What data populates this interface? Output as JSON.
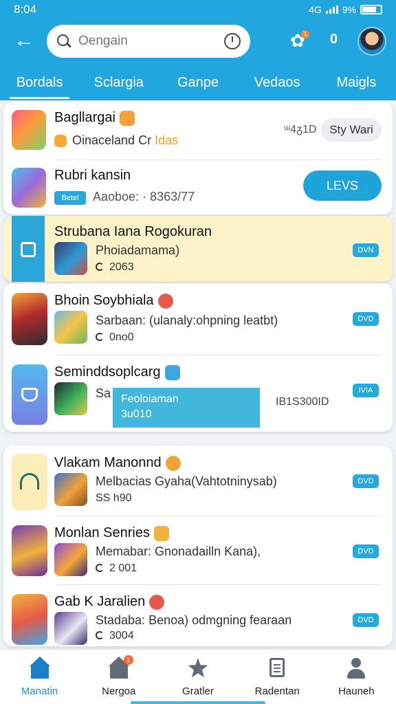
{
  "status": {
    "time": "8:04",
    "network": "4G",
    "battery_label": "9%"
  },
  "header": {
    "search_placeholder": "Oengain",
    "coin_count": "0",
    "notification_count": "1"
  },
  "tabs": [
    "Bordals",
    "Sclargia",
    "Ganpe",
    "Vedaos",
    "Maigls"
  ],
  "top_card": {
    "items": [
      {
        "title": "Bagllargai",
        "sub": "Oinaceland Cr",
        "sub_highlight": "Idas",
        "meta": "ᵚ4ᵹ1D",
        "button": "Sty Wari"
      },
      {
        "title": "Rubri kansin",
        "tag": "Betel",
        "sub": "Aaoboe: ·  8363/77",
        "button": "LEVS"
      }
    ]
  },
  "featured": {
    "title": "Strubana Iana Rogokuran",
    "sub": "Phoiadamama)",
    "meta": "2063",
    "badge": "DVN"
  },
  "card_two": [
    {
      "title": "Bhoin Soybhiala",
      "sub": "Sarbaan: (ulanaly:ohpning leatbt)",
      "meta": "0no0",
      "badge": "DVD"
    },
    {
      "title": "Seminddsoplcarg",
      "sub": "Sa",
      "meta": "",
      "badge": "IVIA",
      "side_meta": "IB1S300ID"
    }
  ],
  "tooltip": {
    "line1": "Feoloiaman",
    "line2": "3u010"
  },
  "card_three": [
    {
      "title": "Vlakam Manonnd",
      "sub": "Melbacias Gyaha(Vahtotninysab)",
      "meta": "SS  h90",
      "badge": "DVD"
    },
    {
      "title": "Monlan Senries",
      "sub": "Memabar: Gnonadailln Kana),",
      "meta": "2 001",
      "badge": "DVD"
    },
    {
      "title": "Gab K Jaralien",
      "sub": "Stadaba: Benoa) odmgning fearaan",
      "meta": "3004",
      "badge": "DVD"
    }
  ],
  "bottom_nav": [
    {
      "label": "Manatin",
      "active": true
    },
    {
      "label": "Nergoa",
      "active": false,
      "badge": "1"
    },
    {
      "label": "Gratler",
      "active": false
    },
    {
      "label": "Radentan",
      "active": false
    },
    {
      "label": "Hauneh",
      "active": false
    }
  ],
  "colors": {
    "primary": "#21a6df",
    "accent": "#1fa4da",
    "featured_bg": "#fdf2c8",
    "badge": "#26a9dc"
  }
}
